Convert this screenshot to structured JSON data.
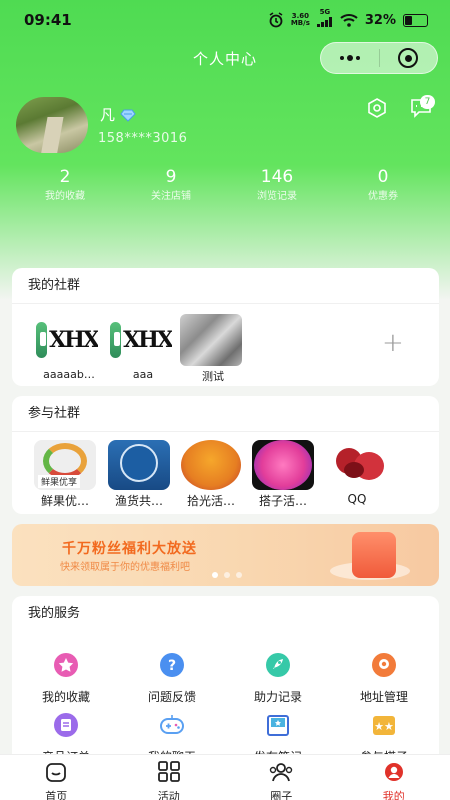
{
  "status_bar": {
    "time": "09:41",
    "speed_value": "3.60",
    "speed_unit": "MB/s",
    "network": "5G",
    "battery": "32%",
    "battery_level": 0.32
  },
  "nav": {
    "title": "个人中心"
  },
  "profile": {
    "name": "凡",
    "phone": "158****3016",
    "message_count": "7"
  },
  "stats": [
    {
      "value": "2",
      "label": "我的收藏"
    },
    {
      "value": "9",
      "label": "关注店铺"
    },
    {
      "value": "146",
      "label": "浏览记录"
    },
    {
      "value": "0",
      "label": "优惠券"
    }
  ],
  "my_groups": {
    "title": "我的社群",
    "items": [
      {
        "label": "aaaaab…",
        "logo_text": "XHX"
      },
      {
        "label": "aaa",
        "logo_text": "XHX"
      },
      {
        "label": "测试"
      }
    ],
    "add_symbol": "+"
  },
  "joined_groups": {
    "title": "参与社群",
    "items": [
      {
        "label": "鲜果优…",
        "tag": "鲜果优享"
      },
      {
        "label": "渔货共…"
      },
      {
        "label": "拾光活…"
      },
      {
        "label": "搭子活…"
      },
      {
        "label": "QQ"
      }
    ]
  },
  "banner": {
    "title": "千万粉丝福利大放送",
    "subtitle": "快来领取属于你的优惠福利吧"
  },
  "services": {
    "title": "我的服务",
    "items": [
      {
        "label": "我的收藏",
        "icon": "star-icon",
        "color": "#e85cb3"
      },
      {
        "label": "问题反馈",
        "icon": "question-icon",
        "color": "#4a8ff0"
      },
      {
        "label": "助力记录",
        "icon": "rocket-icon",
        "color": "#36c9a8"
      },
      {
        "label": "地址管理",
        "icon": "location-icon",
        "color": "#f27b3a"
      },
      {
        "label": "产品订单",
        "icon": "order-icon",
        "color": "#9b6bea"
      },
      {
        "label": "我的聊天",
        "icon": "gamepad-icon",
        "color": "#5aa0f2"
      },
      {
        "label": "发布笔记",
        "icon": "book-icon",
        "color": "#4ab3e0"
      },
      {
        "label": "参与搭子",
        "icon": "partner-icon",
        "color": "#f2b53a"
      }
    ]
  },
  "tabbar": [
    {
      "label": "首页",
      "icon": "home-icon"
    },
    {
      "label": "活动",
      "icon": "grid-icon"
    },
    {
      "label": "圈子",
      "icon": "people-icon"
    },
    {
      "label": "我的",
      "icon": "profile-icon",
      "active": true
    }
  ],
  "colors": {
    "brand_green": "#4fdb52",
    "active_red": "#e0322a",
    "banner_orange": "#f26a1f"
  }
}
